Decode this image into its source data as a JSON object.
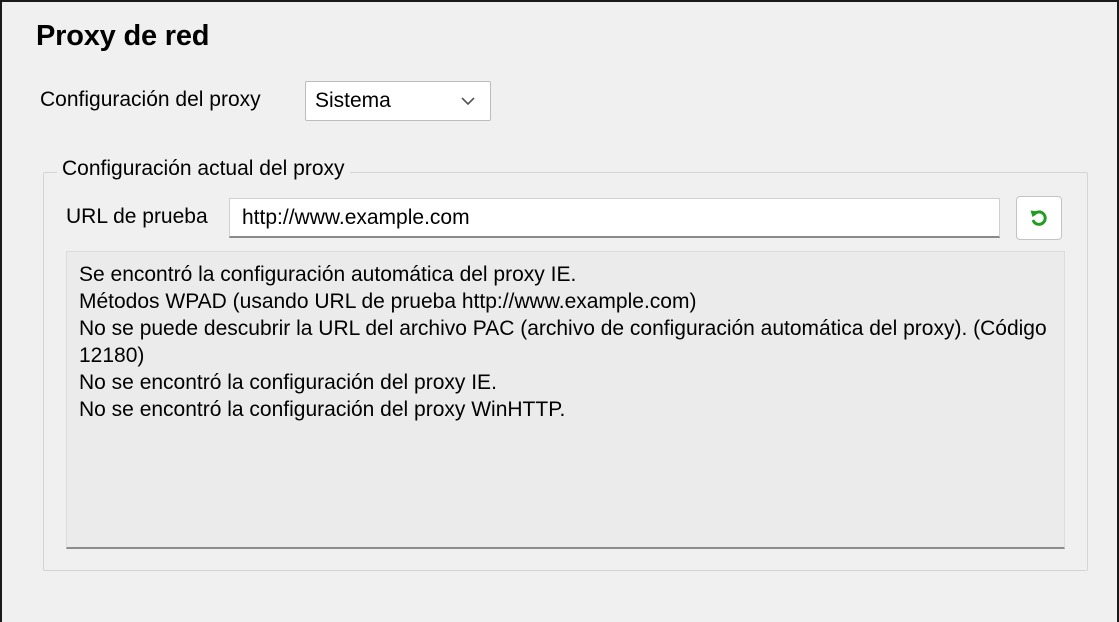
{
  "page": {
    "title": "Proxy de red"
  },
  "proxy_config": {
    "label": "Configuración del proxy",
    "selected": "Sistema",
    "chevron_icon": "chevron-down-icon"
  },
  "current_config": {
    "legend": "Configuración actual del proxy",
    "test_url_label": "URL de prueba",
    "test_url_value": "http://www.example.com",
    "refresh_icon": "refresh-icon",
    "refresh_icon_color": "#1f9e1f",
    "result_lines": [
      "Se encontró la configuración automática del proxy IE.",
      "Métodos WPAD (usando URL de prueba http://www.example.com)",
      "No se puede descubrir la URL del archivo PAC (archivo de configuración automática del proxy). (Código 12180)",
      "No se encontró la configuración del proxy IE.",
      "No se encontró la configuración del proxy WinHTTP."
    ]
  }
}
